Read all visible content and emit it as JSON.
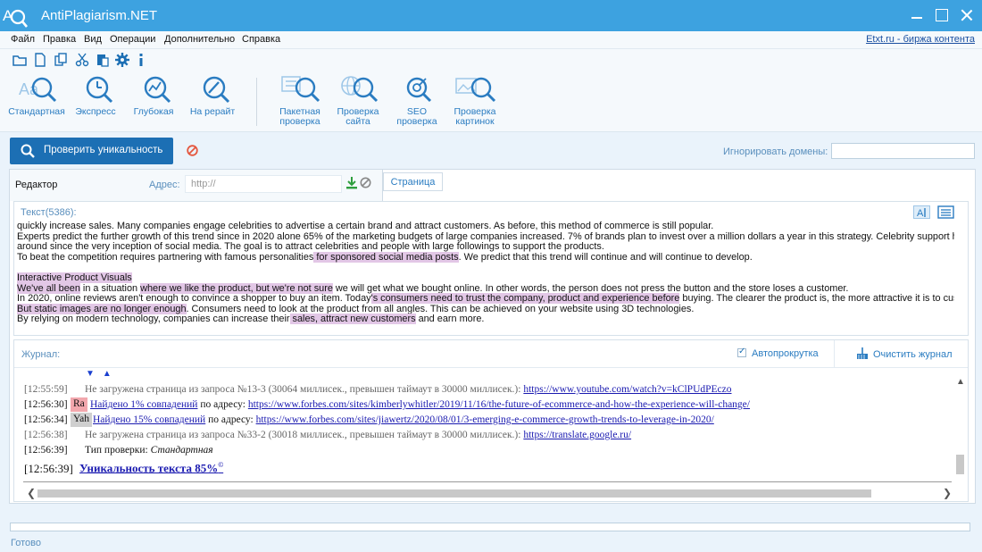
{
  "window": {
    "title": "AntiPlagiarism.NET"
  },
  "menu": {
    "items": [
      "Файл",
      "Правка",
      "Вид",
      "Операции",
      "Дополнительно",
      "Справка"
    ],
    "link": "Etxt.ru - биржа контента"
  },
  "ribbon": {
    "buttons": [
      "Стандартная",
      "Экспресс",
      "Глубокая",
      "На рерайт"
    ],
    "buttons2": [
      {
        "l1": "Пакетная",
        "l2": "проверка"
      },
      {
        "l1": "Проверка",
        "l2": "сайта"
      },
      {
        "l1": "SEO",
        "l2": "проверка"
      },
      {
        "l1": "Проверка",
        "l2": "картинок"
      }
    ]
  },
  "check": {
    "button_label": "Проверить уникальность",
    "ignore_label": "Игнорировать домены:",
    "ignore_value": ""
  },
  "editor": {
    "tab_label": "Редактор",
    "address_label": "Адрес:",
    "address_placeholder": "http://",
    "page_tab": "Страница",
    "text_title": "Текст(5386):"
  },
  "text": {
    "l1": "quickly increase sales. Many companies engage celebrities to advertise a certain brand and attract customers. As before, this method of commerce is still popular.",
    "l2": "Experts predict the further growth of this trend since in 2020 alone 65% of the marketing budgets of large companies increased. 7% of brands plan to invest over a million dollars a year in this strategy. Celebrity support has been",
    "l3": "around since the very inception of social media. The goal is to attract celebrities and people with large followings to support the products.",
    "l4a": "To beat the competition requires partnering with famous personalities",
    "l4b": " for sponsored social media posts",
    "l4c": ". We predict that this trend will continue and will continue to develop.",
    "l5": "Interactive Product Visuals",
    "l6a": "We've all been",
    "l6b": " in a situation ",
    "l6c": "where we like the product, but we're not sure",
    "l6d": " we will get what we bought online. In other words, the person does not press the button and the store loses a customer.",
    "l7a": "In 2020, online reviews aren't enough to convince a shopper to buy an item. Today",
    "l7b": "'s consumers need to trust the company, product and experience before",
    "l7c": " buying. The clearer the product is, the more attractive it is to customers.",
    "l8a": "But static images are no longer enough",
    "l8b": ". Consumers need to look at the product from all angles. This can be achieved on your website using 3D technologies.",
    "l9a": "By relying on modern technology, companies can increase their",
    "l9b": " sales, attract new customers",
    "l9c": " and earn more."
  },
  "journal": {
    "label": "Журнал:",
    "autoscroll": "Автопрокрутка",
    "clear": "Очистить журнал",
    "rows": [
      {
        "time": "[12:55:59]",
        "msg": "Не загружена страница из запроса №13-3 (30064 миллисек., превышен таймаут в 30000 миллисек.): ",
        "url": "https://www.youtube.com/watch?v=kClPUdPEczo"
      },
      {
        "time": "[12:56:30]",
        "badge": "Ra",
        "found": "Найдено 1% совпадений",
        "mid": " по адресу: ",
        "url": "https://www.forbes.com/sites/kimberlywhitler/2019/11/16/the-future-of-ecommerce-and-how-the-experience-will-change/"
      },
      {
        "time": "[12:56:34]",
        "badge": "Yah",
        "found": "Найдено 15% совпадений",
        "mid": " по адресу: ",
        "url": "https://www.forbes.com/sites/jiawertz/2020/08/01/3-emerging-e-commerce-growth-trends-to-leverage-in-2020/"
      },
      {
        "time": "[12:56:38]",
        "msg": "Не загружена страница из запроса №33-2 (30018 миллисек., превышен таймаут в 30000 миллисек.): ",
        "url": "https://translate.google.ru/"
      },
      {
        "time": "[12:56:39]",
        "msg": "Тип проверки: ",
        "em": "Стандартная"
      }
    ],
    "final_time": "[12:56:39]",
    "final_text": "Уникальность текста 85%",
    "final_sup": "©"
  },
  "status": {
    "text": "Готово"
  },
  "colors": {
    "titlebar": "#3da2e0",
    "accent": "#1c6fb4",
    "highlight": "#e2c7e6"
  }
}
